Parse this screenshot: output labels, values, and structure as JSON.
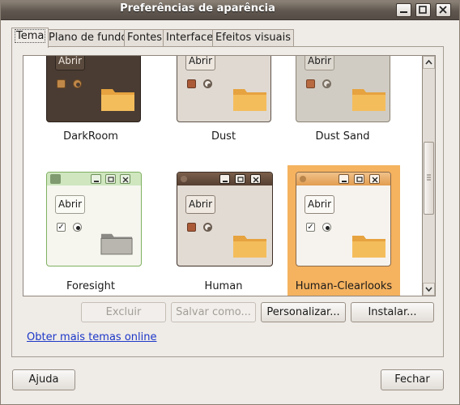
{
  "window": {
    "title": "Preferências de aparência"
  },
  "tabs": [
    "Tema",
    "Plano de fundo",
    "Fontes",
    "Interface",
    "Efeitos visuais"
  ],
  "themes": {
    "r1": {
      "open_label": "Abrir",
      "names": [
        "DarkRoom",
        "Dust",
        "Dust Sand"
      ]
    },
    "r2": {
      "open_label": "Abrir",
      "names": [
        "Foresight",
        "Human",
        "Human-Clearlooks"
      ]
    }
  },
  "selected_theme": "Human-Clearlooks",
  "buttons": {
    "delete": "Excluir",
    "save_as": "Salvar como...",
    "customize": "Personalizar...",
    "install": "Instalar..."
  },
  "link": {
    "more_themes": "Obter mais temas online"
  },
  "footer": {
    "help": "Ajuda",
    "close": "Fechar"
  },
  "colors": {
    "selection": "#f5b25f",
    "titlebar": "#5f574f",
    "link": "#1c37c8"
  }
}
